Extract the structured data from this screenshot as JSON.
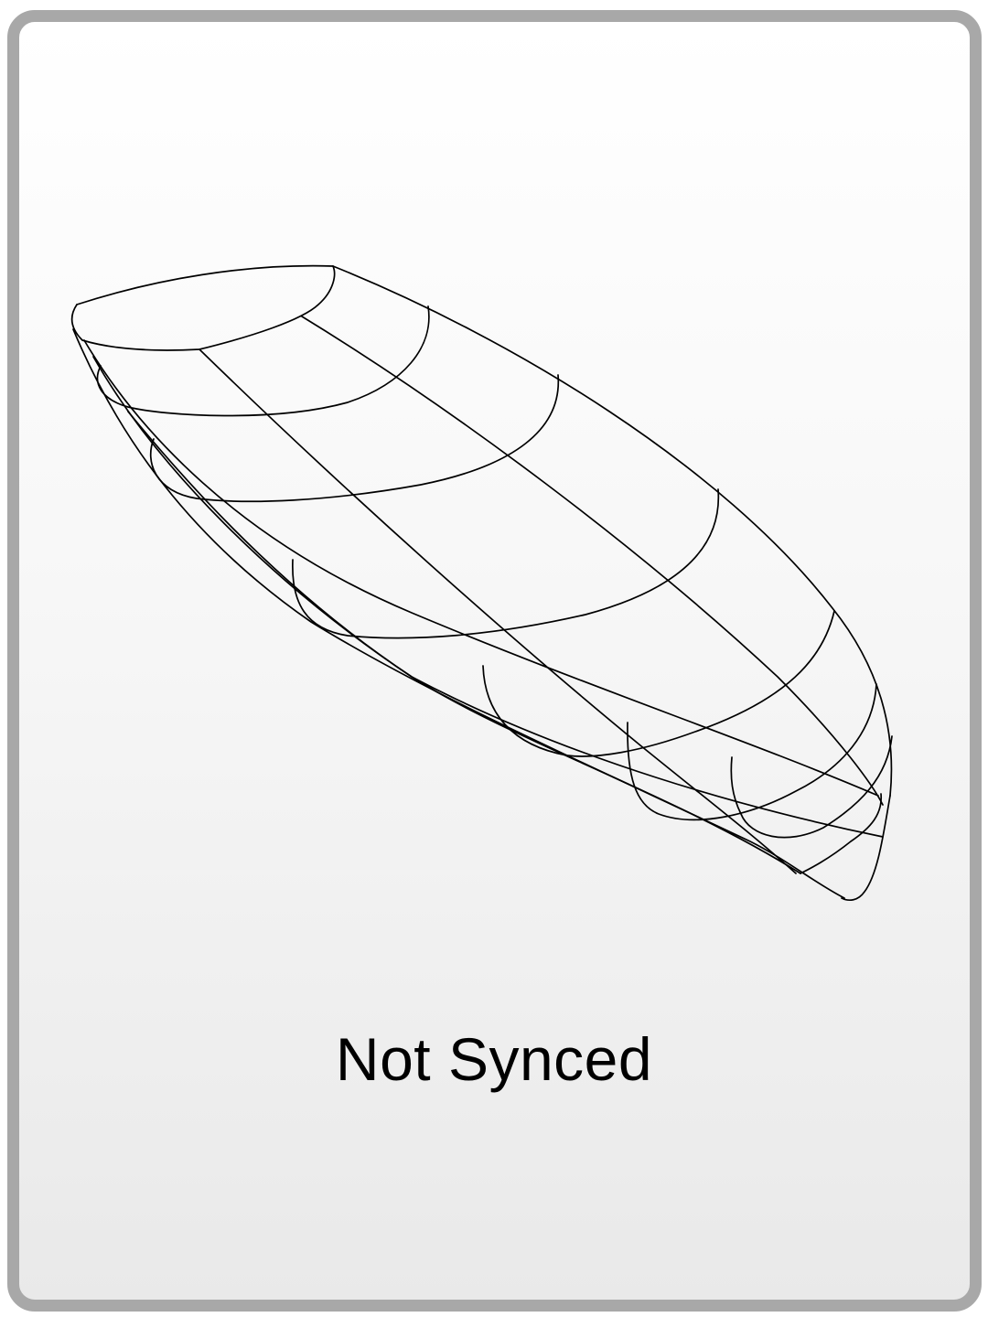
{
  "card": {
    "image_icon": "boat-hull-wireframe-icon",
    "status_text": "Not Synced",
    "colors": {
      "border": "#a8a8a8",
      "background_top": "#ffffff",
      "background_bottom": "#e9e9e9",
      "line": "#000000"
    }
  }
}
